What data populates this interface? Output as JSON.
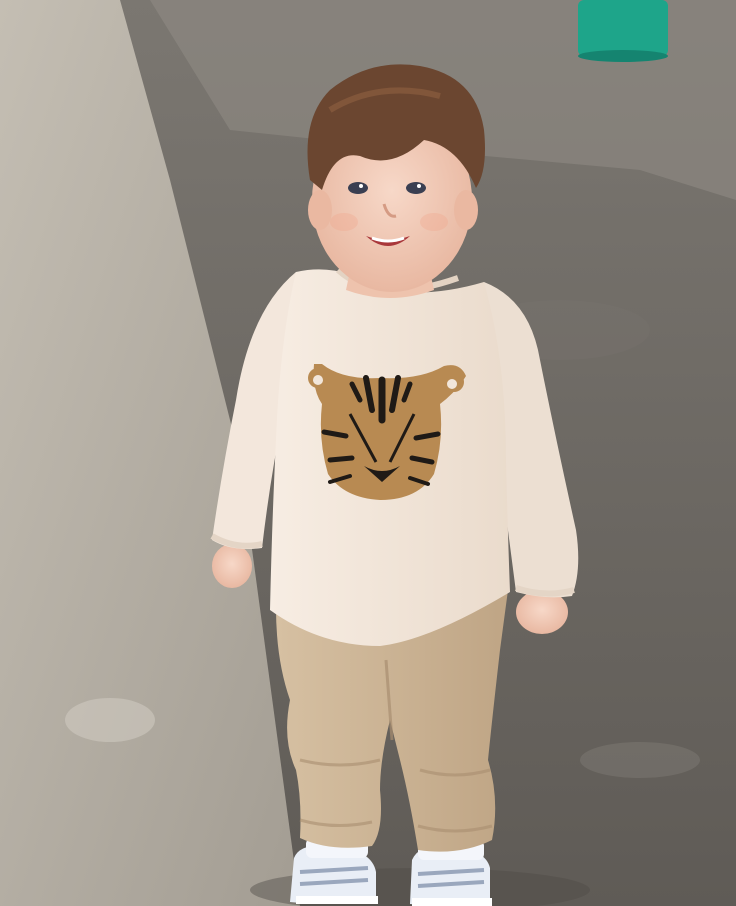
{
  "photo": {
    "subject": "toddler",
    "colors": {
      "ground_shadow": "#6f6b66",
      "ground_sunlit": "#b7b1a6",
      "shirt": "#f2e6da",
      "pants": "#cdb596",
      "tiger_print": "#b88a52",
      "hair": "#6b4630",
      "skin": "#f0c7b2",
      "bucket": "#1ea58a",
      "shoes": "#e9eef6"
    },
    "icons": {
      "shirt_graphic": "tiger-face-icon"
    }
  }
}
